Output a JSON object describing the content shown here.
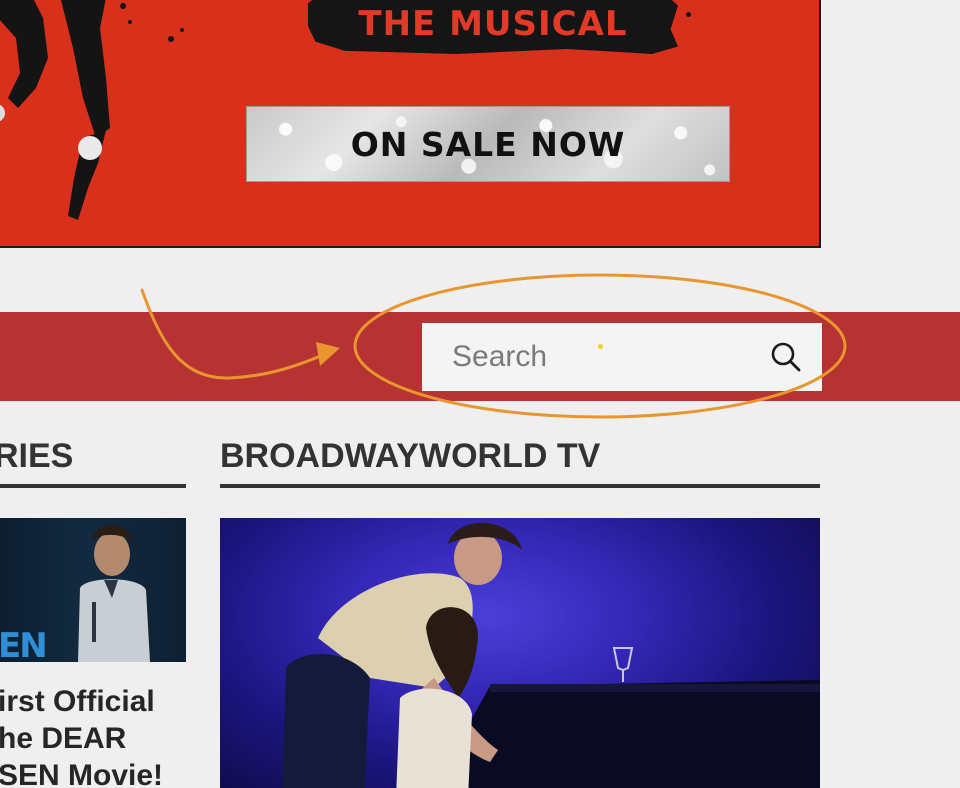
{
  "banner": {
    "title": "THE MUSICAL",
    "cta": "ON SALE NOW"
  },
  "search": {
    "placeholder": "Search",
    "value": ""
  },
  "sections": {
    "stories": {
      "title": "RIES",
      "headline_lines": [
        "irst Official",
        "he DEAR",
        "SEN Movie!"
      ],
      "thumb_text": "EN"
    },
    "tv": {
      "title": "BROADWAYWORLD TV"
    }
  },
  "colors": {
    "banner_red": "#d9301c",
    "nav_red": "#b73232",
    "annotation_orange": "#e8962e",
    "text_dark": "#333333",
    "cursor_yellow": "#f2d21a"
  },
  "icons": {
    "search": "search-icon",
    "annotation_arrow": "arrow-icon",
    "annotation_circle": "highlight-ellipse"
  }
}
